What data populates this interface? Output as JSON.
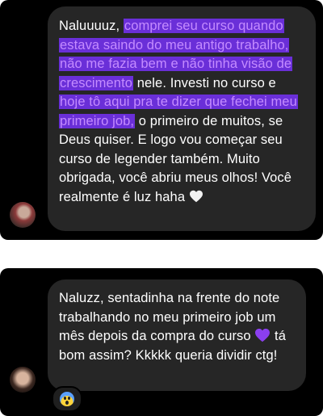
{
  "messages": [
    {
      "segments": [
        {
          "text": "Naluuuuz, ",
          "highlighted": false
        },
        {
          "text": "comprei seu curso quando estava saindo do meu antigo trabalho, não me fazia bem e não tinha visão de crescimento",
          "highlighted": true
        },
        {
          "text": " nele. Investi no curso e ",
          "highlighted": false
        },
        {
          "text": "hoje tô aqui pra te dizer que fechei meu primeiro job,",
          "highlighted": true
        },
        {
          "text": " o primeiro de muitos, se Deus quiser. E logo vou começar seu curso de legender também. Muito obrigada, você abriu meus olhos! Você realmente é luz haha ",
          "highlighted": false
        }
      ],
      "end_icon": "white-heart-icon"
    },
    {
      "text_before_icon": "Naluzz, sentadinha na frente do note trabalhando no meu primeiro job um mês depois da compra do curso ",
      "inline_icon": "purple-heart-icon",
      "text_after_icon": " tá bom assim? Kkkkk queria dividir ctg!",
      "reaction": "scream-emoji"
    }
  ],
  "colors": {
    "panel_bg": "#000000",
    "bubble_bg": "#262626",
    "highlight_bg": "#6a2fd8",
    "highlight_text": "#c48bff",
    "text": "#ffffff"
  }
}
